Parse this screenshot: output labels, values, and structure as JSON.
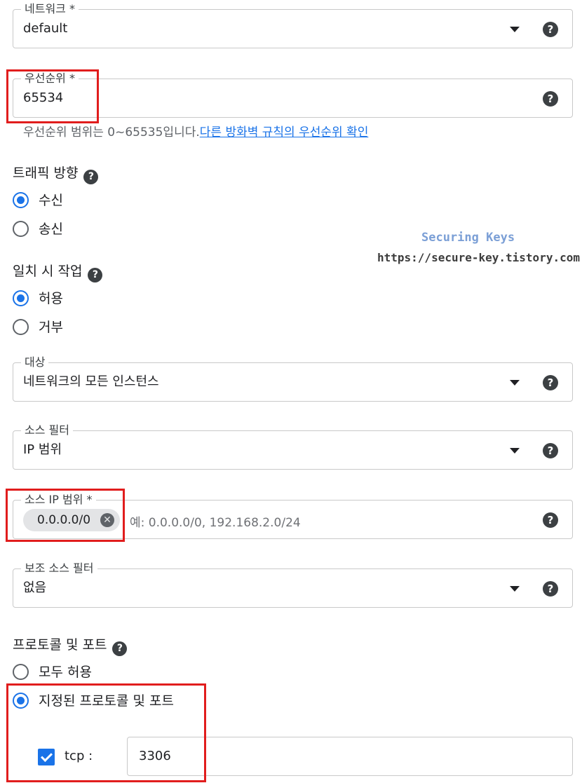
{
  "network": {
    "label": "네트워크 *",
    "value": "default"
  },
  "priority": {
    "label": "우선순위 *",
    "value": "65534",
    "hint": "우선순위 범위는 0~65535입니다.",
    "hint_link": "다른 방화벽 규칙의 우선순위 확인"
  },
  "traffic_direction": {
    "title": "트래픽 방향",
    "options": [
      "수신",
      "송신"
    ],
    "selected": "수신"
  },
  "action_on_match": {
    "title": "일치 시 작업",
    "options": [
      "허용",
      "거부"
    ],
    "selected": "허용"
  },
  "targets": {
    "label": "대상",
    "value": "네트워크의 모든 인스턴스"
  },
  "source_filter": {
    "label": "소스 필터",
    "value": "IP 범위"
  },
  "source_ip_ranges": {
    "label": "소스 IP 범위 *",
    "chip": "0.0.0.0/0",
    "placeholder": "예: 0.0.0.0/0, 192.168.2.0/24"
  },
  "secondary_source_filter": {
    "label": "보조 소스 필터",
    "value": "없음"
  },
  "protocols_ports": {
    "title": "프로토콜 및 포트",
    "options": [
      "모두 허용",
      "지정된 프로토콜 및 포트"
    ],
    "selected": "지정된 프로토콜 및 포트",
    "tcp_label": "tcp :",
    "tcp_checked": true,
    "tcp_value": "3306"
  },
  "watermark": {
    "title": "Securing Keys",
    "url": "https://secure-key.tistory.com"
  },
  "icons": {
    "help": "help-circle-icon",
    "dropdown": "caret-down-icon",
    "remove": "close-circle-icon"
  },
  "colors": {
    "accent": "#1a73e8",
    "highlight": "#e11d1d"
  }
}
